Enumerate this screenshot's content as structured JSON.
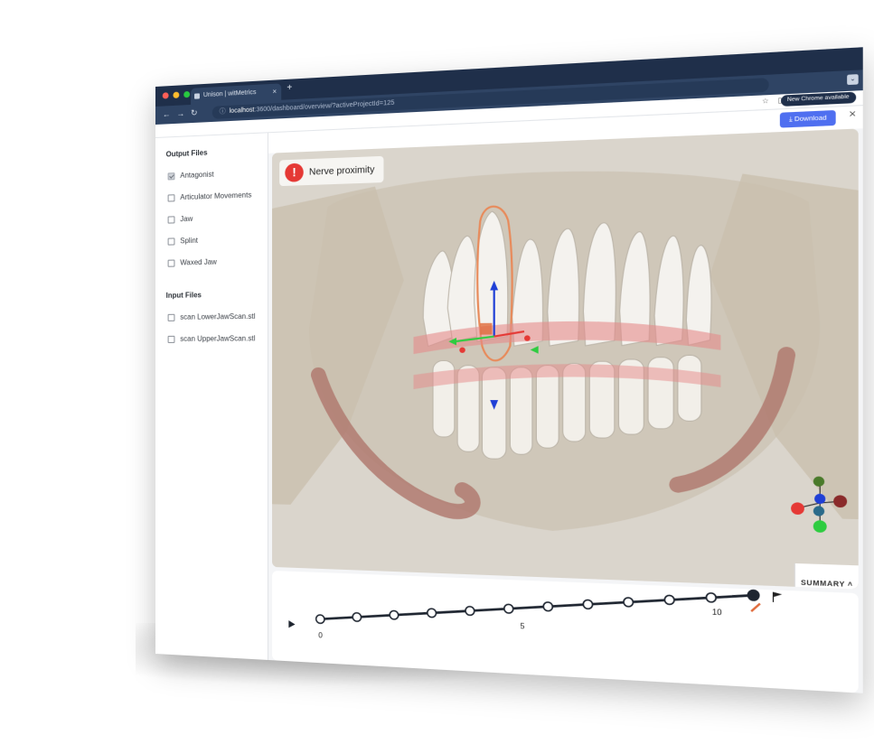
{
  "browser": {
    "tab_title": "Unison | witMetrics",
    "url_host": "localhost",
    "url_path": ":3600/dashboard/overview/?activeProjectId=125",
    "chrome_update_label": "New Chrome available"
  },
  "toolbar": {
    "download_label": "Download",
    "close_label": "×"
  },
  "sidebar": {
    "output_title": "Output Files",
    "output_files": [
      {
        "label": "Antagonist",
        "checked": true
      },
      {
        "label": "Articulator Movements",
        "checked": false
      },
      {
        "label": "Jaw",
        "checked": false
      },
      {
        "label": "Splint",
        "checked": false
      },
      {
        "label": "Waxed Jaw",
        "checked": false
      }
    ],
    "input_title": "Input Files",
    "input_files": [
      {
        "label": "scan LowerJawScan.stl",
        "checked": false
      },
      {
        "label": "scan UpperJawScan.stl",
        "checked": false
      }
    ]
  },
  "viewer": {
    "alert_icon_text": "!",
    "alert_label": "Nerve proximity",
    "summary_label": "SUMMARY ˄",
    "axis_gizmo_colors": {
      "x_pos": "#e53935",
      "x_neg": "#8a2a2a",
      "y_pos": "#2ecc40",
      "y_neg": "#4a7a2a",
      "z_pos": "#1f3fd6",
      "z_neg": "#2a6a8a"
    }
  },
  "timeline": {
    "step_count": 12,
    "labels": {
      "start": "0",
      "mid": "5",
      "end": "10"
    },
    "current_step": 11
  },
  "colors": {
    "titlebar": "#1f2f4a",
    "accent": "#4f6ff0",
    "alert": "#e53935"
  }
}
